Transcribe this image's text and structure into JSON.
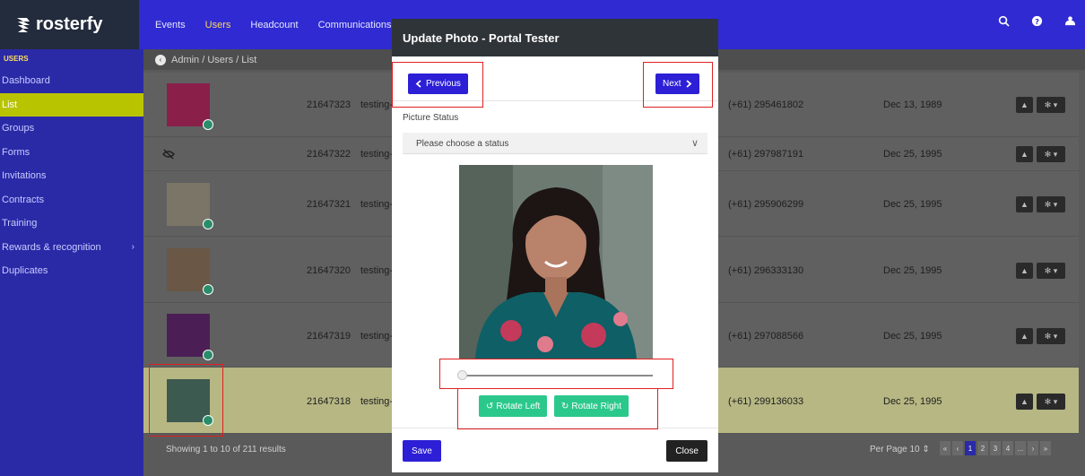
{
  "brand": {
    "name": "rosterfy"
  },
  "topnav": {
    "items": [
      "Events",
      "Users",
      "Headcount",
      "Communications"
    ],
    "active": "Users"
  },
  "top_icons": [
    "search-icon",
    "help-icon",
    "user-menu-icon"
  ],
  "sidebar": {
    "section": "USERS",
    "items": [
      {
        "label": "Dashboard"
      },
      {
        "label": "List"
      },
      {
        "label": "Groups"
      },
      {
        "label": "Forms"
      },
      {
        "label": "Invitations"
      },
      {
        "label": "Contracts"
      },
      {
        "label": "Training"
      },
      {
        "label": "Rewards & recognition",
        "chevron": "›"
      },
      {
        "label": "Duplicates"
      }
    ]
  },
  "breadcrumb": "Admin / Users / List",
  "rows": [
    {
      "id": "21647323",
      "email": "testing-",
      "phone": "(+61) 295461802",
      "dob": "Dec 13, 1989"
    },
    {
      "id": "21647322",
      "email": "testing-",
      "phone": "(+61) 297987191",
      "dob": "Dec 25, 1995"
    },
    {
      "id": "21647321",
      "email": "testing-",
      "phone": "(+61) 295906299",
      "dob": "Dec 25, 1995"
    },
    {
      "id": "21647320",
      "email": "testing-",
      "phone": "(+61) 296333130",
      "dob": "Dec 25, 1995"
    },
    {
      "id": "21647319",
      "email": "testing-",
      "phone": "(+61) 297088566",
      "dob": "Dec 25, 1995"
    },
    {
      "id": "21647318",
      "email": "testing-",
      "phone": "(+61) 299136033",
      "dob": "Dec 25, 1995"
    }
  ],
  "footer": {
    "showing": "Showing 1 to 10 of 211 results",
    "per_page_label": "Per Page",
    "per_page_value": "10",
    "pages": [
      "«",
      "‹",
      "1",
      "2",
      "3",
      "4",
      "...",
      "›",
      "»"
    ],
    "current_page": "1"
  },
  "modal": {
    "title": "Update Photo - Portal Tester",
    "prev_label": "Previous",
    "next_label": "Next",
    "status_label": "Picture Status",
    "status_placeholder": "Please choose a status",
    "zoom_fraction": 0.0,
    "rotate_left_label": "Rotate Left",
    "rotate_right_label": "Rotate Right",
    "save_label": "Save",
    "close_label": "Close"
  },
  "colors": {
    "topbar": "#2f2ad2",
    "sidebar": "#2a2aa7",
    "accent_yellow": "#ffd95a",
    "sidebar_active": "#b9c400",
    "primary_button": "#2c1fd6",
    "rotate_button": "#2bc88c",
    "highlight_annotation": "#e02020"
  }
}
